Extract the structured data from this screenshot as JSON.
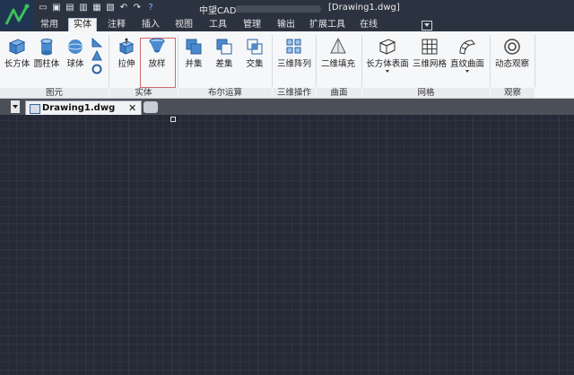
{
  "app": {
    "name": "中望CAD",
    "document_title": "[Drawing1.dwg]"
  },
  "quick_access": [
    "new-icon",
    "open-icon",
    "save-icon",
    "save-as-icon",
    "print-icon",
    "print-preview-icon",
    "undo-icon",
    "redo-icon",
    "help-icon"
  ],
  "tabs": [
    {
      "label": "常用",
      "active": false
    },
    {
      "label": "实体",
      "active": true
    },
    {
      "label": "注释",
      "active": false
    },
    {
      "label": "插入",
      "active": false
    },
    {
      "label": "视图",
      "active": false
    },
    {
      "label": "工具",
      "active": false
    },
    {
      "label": "管理",
      "active": false
    },
    {
      "label": "输出",
      "active": false
    },
    {
      "label": "扩展工具",
      "active": false
    },
    {
      "label": "在线",
      "active": false
    }
  ],
  "ribbon": {
    "buttons": {
      "box": "长方体",
      "cylinder": "圆柱体",
      "sphere": "球体",
      "extrude": "拉伸",
      "loft": "放样",
      "union": "并集",
      "subtract": "差集",
      "intersect": "交集",
      "array3d": "三维阵列",
      "planar_fill": "二维填充",
      "box_surface": "长方体表面",
      "mesh3d": "三维网格",
      "ruled_surface": "直纹曲面",
      "orbit": "动态观察"
    },
    "groups": {
      "primitive": "图元",
      "solid": "实体",
      "boolean": "布尔运算",
      "operation3d": "三维操作",
      "surface": "曲面",
      "mesh": "网格",
      "view": "观察"
    }
  },
  "document_tabs": [
    {
      "label": "Drawing1.dwg",
      "active": true
    }
  ],
  "colors": {
    "titlebar": "#2c3340",
    "ribbon": "#f6f7f9",
    "canvas": "#252a36",
    "accent": "#2f6fbf"
  }
}
